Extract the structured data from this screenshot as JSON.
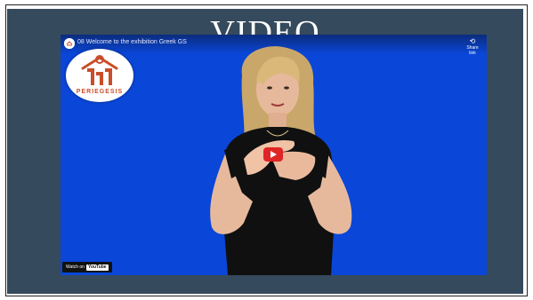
{
  "slide": {
    "title": "VIDEO"
  },
  "player": {
    "video_title": "08 Welcome to the exhibition  Greek GS",
    "share_label": "Share link",
    "logo_text": "PERIEGESIS",
    "watch_on_label": "Watch on",
    "youtube_label": "YouTube",
    "colors": {
      "background": "#0a46d8",
      "play": "#e02525",
      "slide": "#354a5c"
    }
  }
}
